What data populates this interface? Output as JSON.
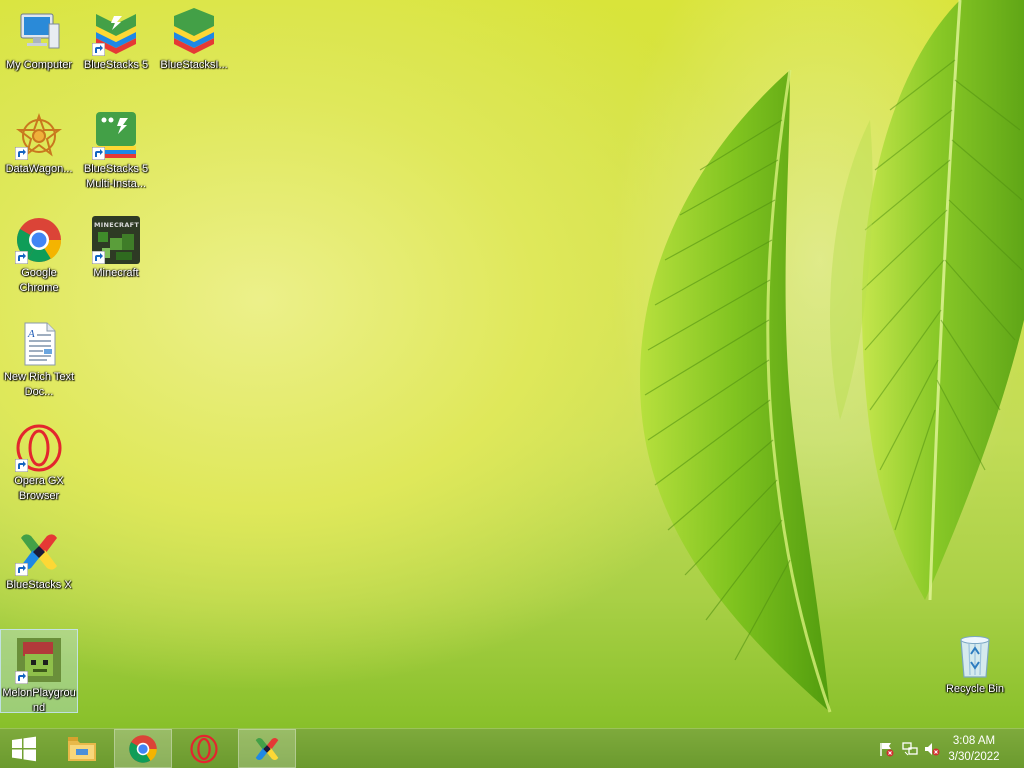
{
  "desktop": {
    "icons": [
      {
        "label": "My Computer",
        "icon": "computer-icon"
      },
      {
        "label": "BlueStacks 5",
        "icon": "bluestacks-icon"
      },
      {
        "label": "BlueStacksI...",
        "icon": "bluestacks-installer-icon"
      },
      {
        "label": "DataWagon...",
        "icon": "datawagon-icon"
      },
      {
        "label": "BlueStacks 5 Multi-Insta...",
        "icon": "bluestacks-multi-instance-icon"
      },
      {
        "label": "Google Chrome",
        "icon": "chrome-icon"
      },
      {
        "label": "Minecraft",
        "icon": "minecraft-icon"
      },
      {
        "label": "New Rich Text Doc...",
        "icon": "rich-text-document-icon"
      },
      {
        "label": "Opera GX Browser",
        "icon": "opera-gx-icon"
      },
      {
        "label": "BlueStacks X",
        "icon": "bluestacks-x-icon"
      },
      {
        "label": "MelonPlayground",
        "icon": "melon-playground-icon"
      },
      {
        "label": "Recycle Bin",
        "icon": "recycle-bin-icon"
      }
    ],
    "minecraft_logo_text": "MINECRAFT"
  },
  "taskbar": {
    "pinned": [
      "start-icon",
      "file-explorer-icon",
      "chrome-icon",
      "opera-gx-icon",
      "bluestacks-x-icon"
    ],
    "clock": {
      "time": "3:08 AM",
      "date": "3/30/2022"
    },
    "tray": [
      "action-center-flag-icon",
      "network-icon",
      "volume-muted-icon"
    ]
  },
  "colors": {
    "taskbar": "#6f9e31",
    "wallpaper_primary": "#d6e33f",
    "leaf": "#7cc21c"
  }
}
